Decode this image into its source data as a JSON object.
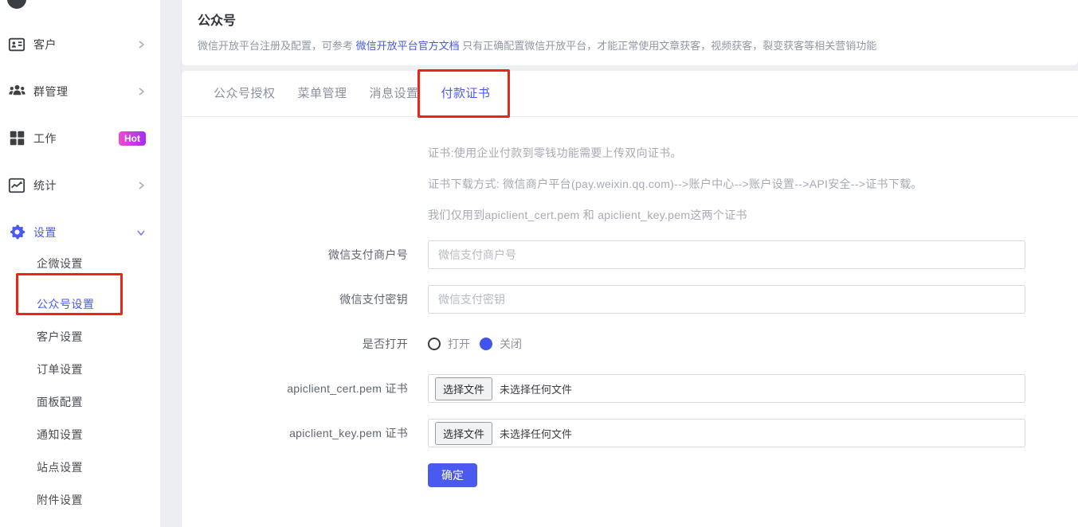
{
  "sidebar": {
    "items": [
      {
        "label": "客户",
        "icon": "id-card-icon"
      },
      {
        "label": "群管理",
        "icon": "group-icon"
      },
      {
        "label": "工作",
        "icon": "grid-icon",
        "badge": "Hot"
      },
      {
        "label": "统计",
        "icon": "chart-icon"
      },
      {
        "label": "设置",
        "icon": "gear-icon"
      }
    ],
    "subitems": [
      {
        "label": "企微设置"
      },
      {
        "label": "公众号设置"
      },
      {
        "label": "客户设置"
      },
      {
        "label": "订单设置"
      },
      {
        "label": "面板配置"
      },
      {
        "label": "通知设置"
      },
      {
        "label": "站点设置"
      },
      {
        "label": "附件设置"
      }
    ]
  },
  "header": {
    "title": "公众号",
    "subtitle_prefix": "微信开放平台注册及配置，可参考 ",
    "subtitle_link": "微信开放平台官方文档",
    "subtitle_suffix": " 只有正确配置微信开放平台，才能正常使用文章获客，视频获客，裂变获客等相关营销功能"
  },
  "tabs": [
    {
      "label": "公众号授权"
    },
    {
      "label": "菜单管理"
    },
    {
      "label": "消息设置"
    },
    {
      "label": "付款证书",
      "active": true
    }
  ],
  "panel": {
    "info_lines": [
      "证书:使用企业付款到零钱功能需要上传双向证书。",
      "证书下载方式: 微信商户平台(pay.weixin.qq.com)-->账户中心-->账户设置-->API安全-->证书下载。",
      "我们仅用到apiclient_cert.pem 和 apiclient_key.pem这两个证书"
    ],
    "form": {
      "merchant_label": "微信支付商户号",
      "merchant_placeholder": "微信支付商户号",
      "secret_label": "微信支付密钥",
      "secret_placeholder": "微信支付密钥",
      "toggle_label": "是否打开",
      "toggle_on": "打开",
      "toggle_off": "关闭",
      "toggle_selected": "关闭",
      "cert_label": "apiclient_cert.pem 证书",
      "key_label": "apiclient_key.pem 证书",
      "file_button_label": "选择文件",
      "file_empty_text": "未选择任何文件",
      "submit_label": "确定"
    }
  },
  "colors": {
    "accent": "#4a5af0",
    "link": "#4a5ae0",
    "badge_gradient_from": "#ee4bd2",
    "badge_gradient_to": "#a42cf6",
    "annotation_red": "#ee2418"
  }
}
